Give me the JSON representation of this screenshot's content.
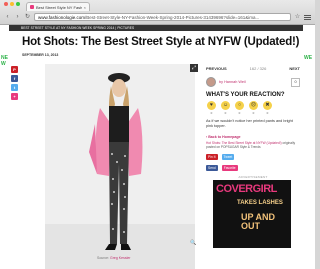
{
  "browser": {
    "tab_title": "Best Street Style NY Fashion",
    "url_domain": "www.fashionologie.com",
    "url_path": "/Best-Street-Style-NY-Fashion-Week-Spring-2014-Pictures-31439696?slide=161&ima..."
  },
  "site": {
    "section_bar": "BEST STREET STYLE AT NY FASHION WEEK SPRING 2014 | PICTURES"
  },
  "article": {
    "headline": "Hot Shots: The Best Street Style at NYFW (Updated!)",
    "date": "SEPTEMBER 13, 2013",
    "photo_credit_label": "Source:",
    "photo_credit_name": "Greg Kessler"
  },
  "share": {
    "pinterest": "P",
    "facebook": "f",
    "twitter": "t",
    "more": "+"
  },
  "pagination": {
    "previous": "PREVIOUS",
    "pager": "162 / 326",
    "next": "NEXT"
  },
  "author": {
    "byline": "by Hannah Weil",
    "comments": "0"
  },
  "reactions": {
    "title": "WHAT'S YOUR REACTION?",
    "counts": [
      "0",
      "0",
      "0",
      "0",
      "0"
    ]
  },
  "caption": "As if we wouldn't notice her printed pants and bright pink topper.",
  "related": {
    "back_link": "‹ Back to Homepage",
    "title": "Hot Shots: The Best Street Style at NYFW (Updated!)",
    "source": "originally posted on POPSUGAR Style & Trends"
  },
  "social_buttons": {
    "pin": "Pin It",
    "tweet": "Tweet",
    "send": "Send",
    "favorite": "Favorite"
  },
  "ad": {
    "label": "ADVERTISEMENT",
    "brand": "COVERGIRL",
    "tagline_1": "TAKES LASHES",
    "tagline_2": "UP AND OUT"
  },
  "side_ads": {
    "left_text": "NEW",
    "right_text": "WE"
  },
  "colors": {
    "brand_pink": "#c0306e",
    "pinterest": "#cb2027",
    "facebook": "#3b5998",
    "twitter": "#55acee"
  }
}
